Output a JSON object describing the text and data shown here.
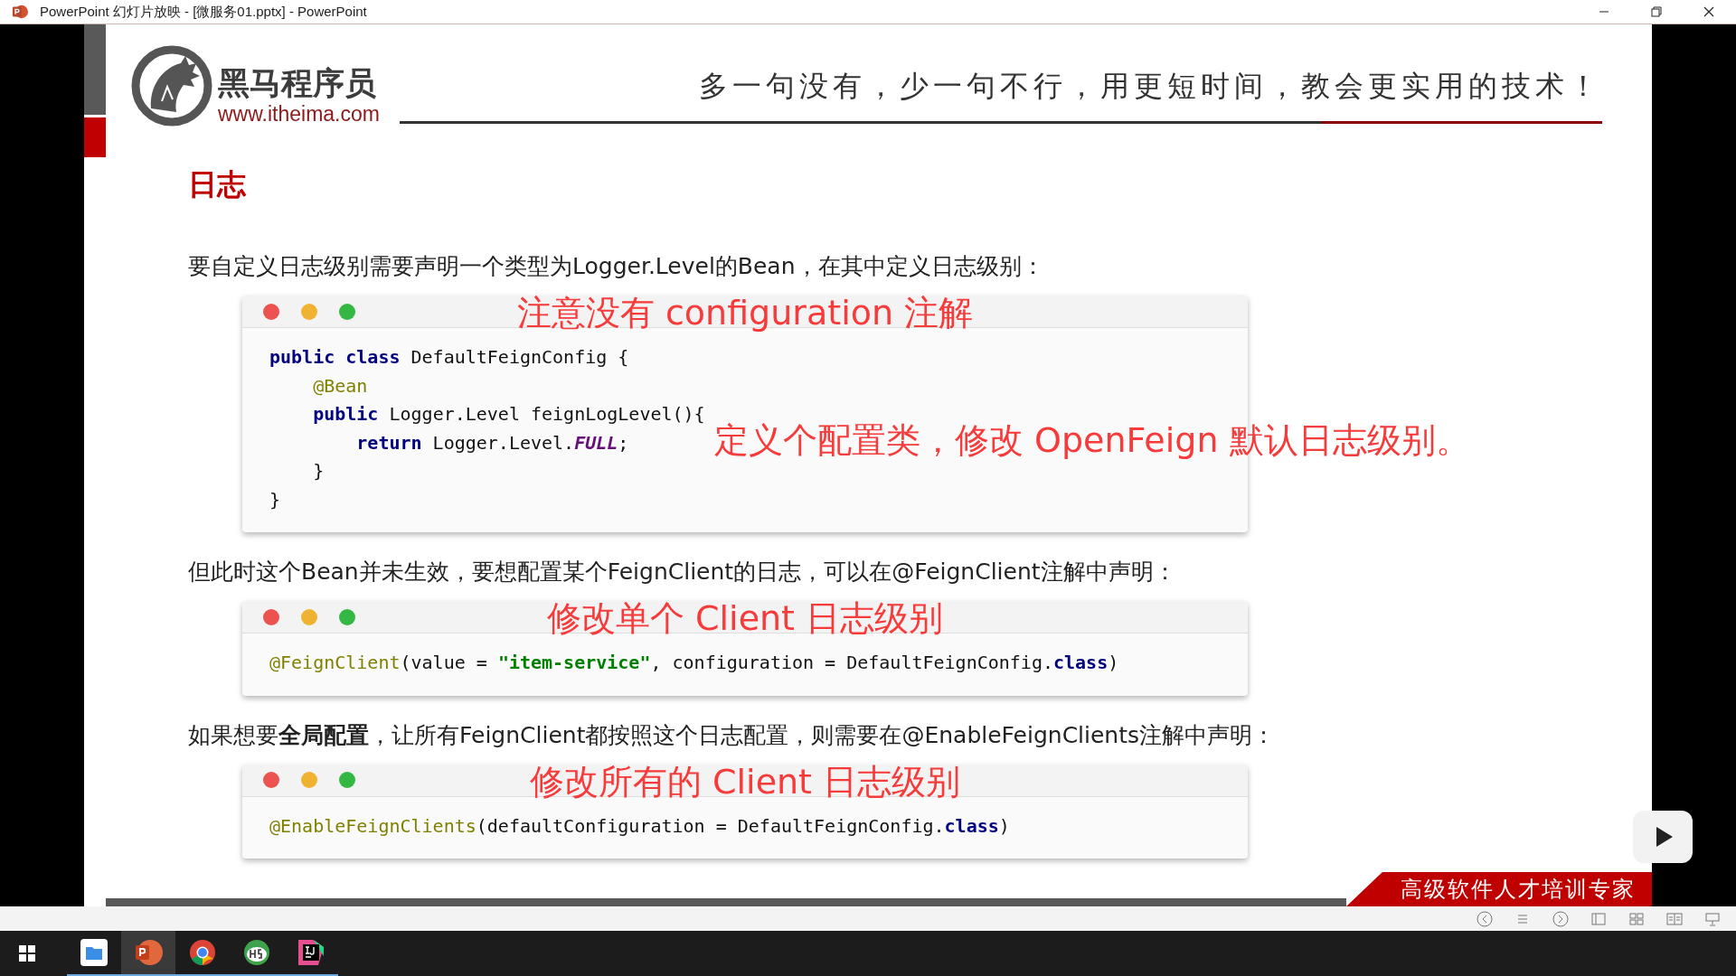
{
  "window": {
    "title": "PowerPoint 幻灯片放映 - [微服务01.pptx] - PowerPoint"
  },
  "slide": {
    "logo": {
      "name": "黑马程序员",
      "url": "www.itheima.com"
    },
    "slogan": "多一句没有，少一句不行，用更短时间，教会更实用的技术！",
    "heading": "日志",
    "blocks": [
      {
        "kind": "paragraph",
        "text": "要自定义日志级别需要声明一个类型为Logger.Level的Bean，在其中定义日志级别："
      },
      {
        "kind": "code",
        "lines": [
          [
            {
              "t": "public class",
              "kind": "keyword"
            },
            {
              "t": " DefaultFeignConfig {",
              "kind": "plain"
            }
          ],
          [
            {
              "t": "    @Bean",
              "kind": "annotation"
            }
          ],
          [
            {
              "t": "    public",
              "kind": "keyword"
            },
            {
              "t": " Logger.Level feignLogLevel(){",
              "kind": "plain"
            }
          ],
          [
            {
              "t": "        return",
              "kind": "keyword"
            },
            {
              "t": " Logger.Level.",
              "kind": "plain"
            },
            {
              "t": "FULL",
              "kind": "constant"
            },
            {
              "t": ";",
              "kind": "plain"
            }
          ],
          [
            {
              "t": "    }",
              "kind": "plain"
            }
          ],
          [
            {
              "t": "}",
              "kind": "plain"
            }
          ]
        ],
        "notes": [
          "注意没有 configuration 注解",
          "定义个配置类，修改 OpenFeign 默认日志级别。"
        ]
      },
      {
        "kind": "paragraph",
        "text": "但此时这个Bean并未生效，要想配置某个FeignClient的日志，可以在@FeignClient注解中声明："
      },
      {
        "kind": "code",
        "lines": [
          [
            {
              "t": "@FeignClient",
              "kind": "annotation"
            },
            {
              "t": "(value = ",
              "kind": "plain"
            },
            {
              "t": "\"item-service\"",
              "kind": "string"
            },
            {
              "t": ", configuration = DefaultFeignConfig.",
              "kind": "plain"
            },
            {
              "t": "class",
              "kind": "keyword"
            },
            {
              "t": ")",
              "kind": "plain"
            }
          ]
        ],
        "notes": [
          "修改单个 Client 日志级别"
        ]
      },
      {
        "kind": "paragraph",
        "text": "如果想要**全局配置**，让所有FeignClient都按照这个日志配置，则需要在@EnableFeignClients注解中声明："
      },
      {
        "kind": "code",
        "lines": [
          [
            {
              "t": "@EnableFeignClients",
              "kind": "annotation"
            },
            {
              "t": "(defaultConfiguration = DefaultFeignConfig.",
              "kind": "plain"
            },
            {
              "t": "class",
              "kind": "keyword"
            },
            {
              "t": ")",
              "kind": "plain"
            }
          ]
        ],
        "notes": [
          "修改所有的 Client 日志级别"
        ]
      }
    ],
    "banner": "高级软件人才培训专家"
  },
  "taskbar": {
    "apps": [
      {
        "kind": "files",
        "selected": false
      },
      {
        "kind": "powerpoint",
        "selected": true
      },
      {
        "kind": "chrome",
        "selected": false
      },
      {
        "kind": "hbuilder",
        "selected": false
      },
      {
        "kind": "intellij",
        "selected": false
      }
    ]
  }
}
